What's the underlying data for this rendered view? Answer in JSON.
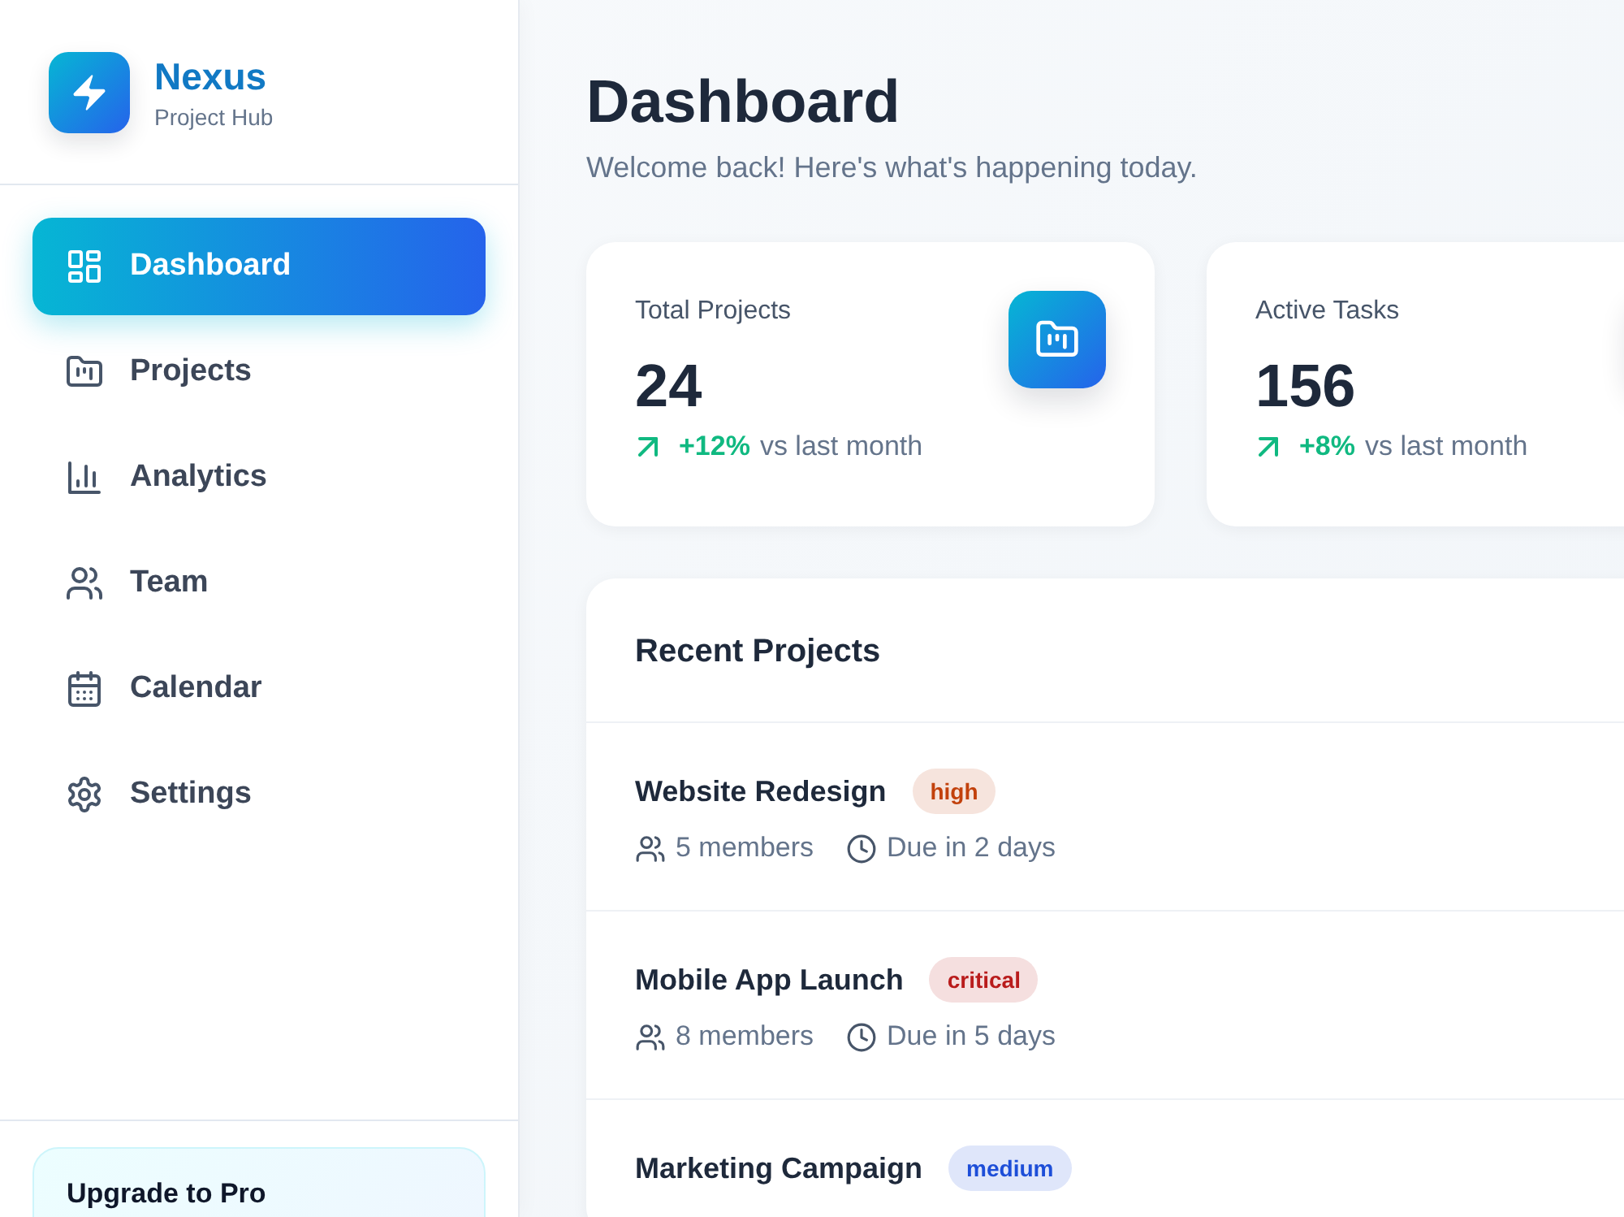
{
  "brand": {
    "name": "Nexus",
    "tagline": "Project Hub"
  },
  "nav": [
    {
      "label": "Dashboard",
      "selected": true
    },
    {
      "label": "Projects",
      "selected": false
    },
    {
      "label": "Analytics",
      "selected": false
    },
    {
      "label": "Team",
      "selected": false
    },
    {
      "label": "Calendar",
      "selected": false
    },
    {
      "label": "Settings",
      "selected": false
    }
  ],
  "upgrade": {
    "title": "Upgrade to Pro"
  },
  "header": {
    "title": "Dashboard",
    "subtitle": "Welcome back! Here's what's happening today."
  },
  "stats": [
    {
      "label": "Total Projects",
      "value": "24",
      "change": "+12%",
      "note": "vs last month"
    },
    {
      "label": "Active Tasks",
      "value": "156",
      "change": "+8%",
      "note": "vs last month"
    }
  ],
  "recent_projects": {
    "title": "Recent Projects",
    "projects": [
      {
        "name": "Website Redesign",
        "priority": "high",
        "color": "#c2410c",
        "members": "5 members",
        "due": "Due in 2 days"
      },
      {
        "name": "Mobile App Launch",
        "priority": "critical",
        "color": "#b91c1c",
        "members": "8 members",
        "due": "Due in 5 days"
      },
      {
        "name": "Marketing Campaign",
        "priority": "medium",
        "color": "#1d4ed8"
      }
    ]
  }
}
